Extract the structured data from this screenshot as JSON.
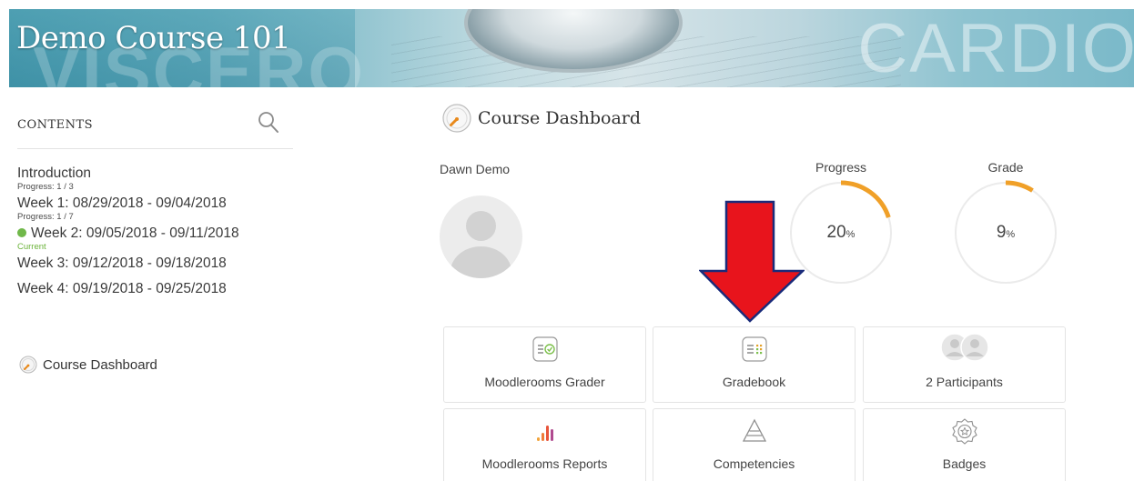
{
  "banner": {
    "course_title": "Demo Course 101",
    "watermark_left": "VISCERO",
    "watermark_right": "CARDIO"
  },
  "sidebar": {
    "heading": "CONTENTS",
    "search_icon": "search-icon",
    "items": [
      {
        "label": "Introduction",
        "sub": "Progress: 1 / 3"
      },
      {
        "label": "Week 1: 08/29/2018 - 09/04/2018",
        "sub": "Progress: 1 / 7"
      },
      {
        "label": "Week 2: 09/05/2018 - 09/11/2018",
        "sub": "Current",
        "current": true
      },
      {
        "label": "Week 3: 09/12/2018 - 09/18/2018"
      },
      {
        "label": "Week 4: 09/19/2018 - 09/25/2018"
      }
    ],
    "dashboard_link": "Course Dashboard"
  },
  "main": {
    "heading": "Course Dashboard",
    "user_name": "Dawn Demo",
    "progress": {
      "label": "Progress",
      "value": "20",
      "unit": "%",
      "fraction": 0.2
    },
    "grade": {
      "label": "Grade",
      "value": "9",
      "unit": "%",
      "fraction": 0.09
    },
    "tiles": [
      {
        "label": "Moodlerooms Grader",
        "icon": "grader-icon"
      },
      {
        "label": "Gradebook",
        "icon": "gradebook-icon"
      },
      {
        "label": "2 Participants",
        "icon": "participants-icon"
      },
      {
        "label": "Moodlerooms Reports",
        "icon": "reports-icon"
      },
      {
        "label": "Competencies",
        "icon": "competencies-icon"
      },
      {
        "label": "Badges",
        "icon": "badge-icon"
      }
    ]
  },
  "colors": {
    "accent_orange": "#f0a028",
    "current_green": "#70b84a",
    "arrow_red": "#e8141c"
  }
}
